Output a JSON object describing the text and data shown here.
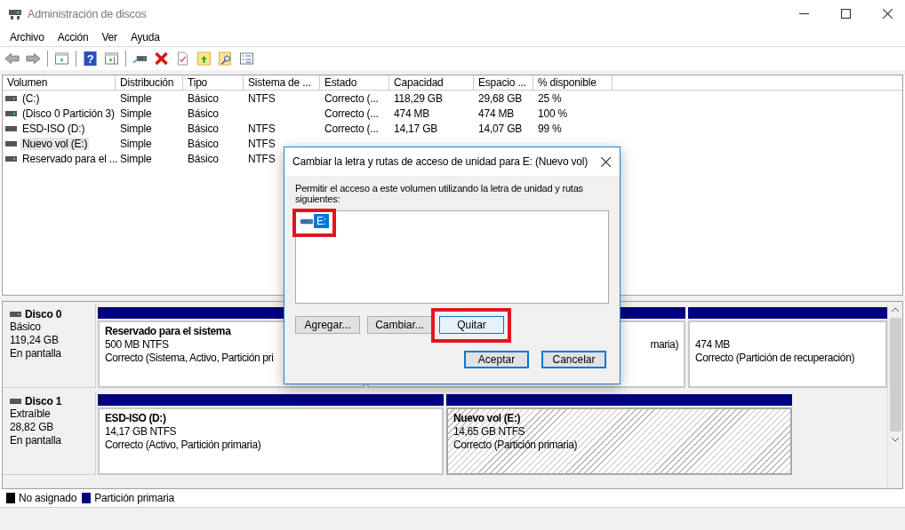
{
  "window": {
    "title": "Administración de discos"
  },
  "menu": [
    "Archivo",
    "Acción",
    "Ver",
    "Ayuda"
  ],
  "toolbar": {
    "help_glyph": "?"
  },
  "table": {
    "columns": [
      "Volumen",
      "Distribución",
      "Tipo",
      "Sistema de ...",
      "Estado",
      "Capacidad",
      "Espacio ...",
      "% disponible"
    ],
    "rows": [
      {
        "kind": "fixed",
        "selected": false,
        "cells": [
          "(C:)",
          "Simple",
          "Básico",
          "NTFS",
          "Correcto (...",
          "118,29 GB",
          "29,68 GB",
          "25 %"
        ]
      },
      {
        "kind": "fixed",
        "selected": false,
        "cells": [
          "(Disco 0 Partición 3)",
          "Simple",
          "Básico",
          "",
          "Correcto (...",
          "474 MB",
          "474 MB",
          "100 %"
        ]
      },
      {
        "kind": "removable",
        "selected": false,
        "cells": [
          "ESD-ISO (D:)",
          "Simple",
          "Básico",
          "NTFS",
          "Correcto (...",
          "14,17 GB",
          "14,07 GB",
          "99 %"
        ]
      },
      {
        "kind": "removable",
        "selected": true,
        "cells": [
          "Nuevo vol (E:)",
          "Simple",
          "Básico",
          "NTFS"
        ]
      },
      {
        "kind": "fixed",
        "selected": false,
        "cells": [
          "Reservado para el ...",
          "Simple",
          "Básico",
          "NTFS"
        ]
      }
    ]
  },
  "disks": [
    {
      "name": "Disco 0",
      "kind": "fixed",
      "lines": [
        "Básico",
        "119,24 GB",
        "En pantalla"
      ],
      "partitions": [
        {
          "title": "Reservado para el sistema",
          "size": "500 MB NTFS",
          "status": "Correcto (Sistema, Activo, Partición pri",
          "selected": false
        },
        {
          "status": "maria)",
          "selected": false
        },
        {
          "size": "474 MB",
          "status": "Correcto (Partición de recuperación)",
          "selected": false
        }
      ]
    },
    {
      "name": "Disco 1",
      "kind": "removable",
      "lines": [
        "Extraíble",
        "28,82 GB",
        "En pantalla"
      ],
      "partitions": [
        {
          "title": "ESD-ISO  (D:)",
          "size": "14,17 GB NTFS",
          "status": "Correcto (Activo, Partición primaria)",
          "selected": false
        },
        {
          "title": "Nuevo vol  (E:)",
          "size": "14,65 GB NTFS",
          "status": "Correcto (Partición primaria)",
          "selected": true
        }
      ]
    }
  ],
  "legend": [
    {
      "label": "No asignado",
      "color": "#000000"
    },
    {
      "label": "Partición primaria",
      "color": "#000080"
    }
  ],
  "dialog": {
    "title": "Cambiar la letra y rutas de acceso de unidad para E: (Nuevo vol)",
    "description": "Permitir el acceso a este volumen utilizando la letra de unidad y rutas siguientes:",
    "items": [
      {
        "label": "E:",
        "selected": true,
        "highlighted": true
      }
    ],
    "buttons": [
      {
        "label": "Agregar...",
        "highlighted": false
      },
      {
        "label": "Cambiar...",
        "highlighted": false
      },
      {
        "label": "Quitar",
        "highlighted": true
      }
    ],
    "footer_buttons": [
      "Aceptar",
      "Cancelar"
    ]
  }
}
